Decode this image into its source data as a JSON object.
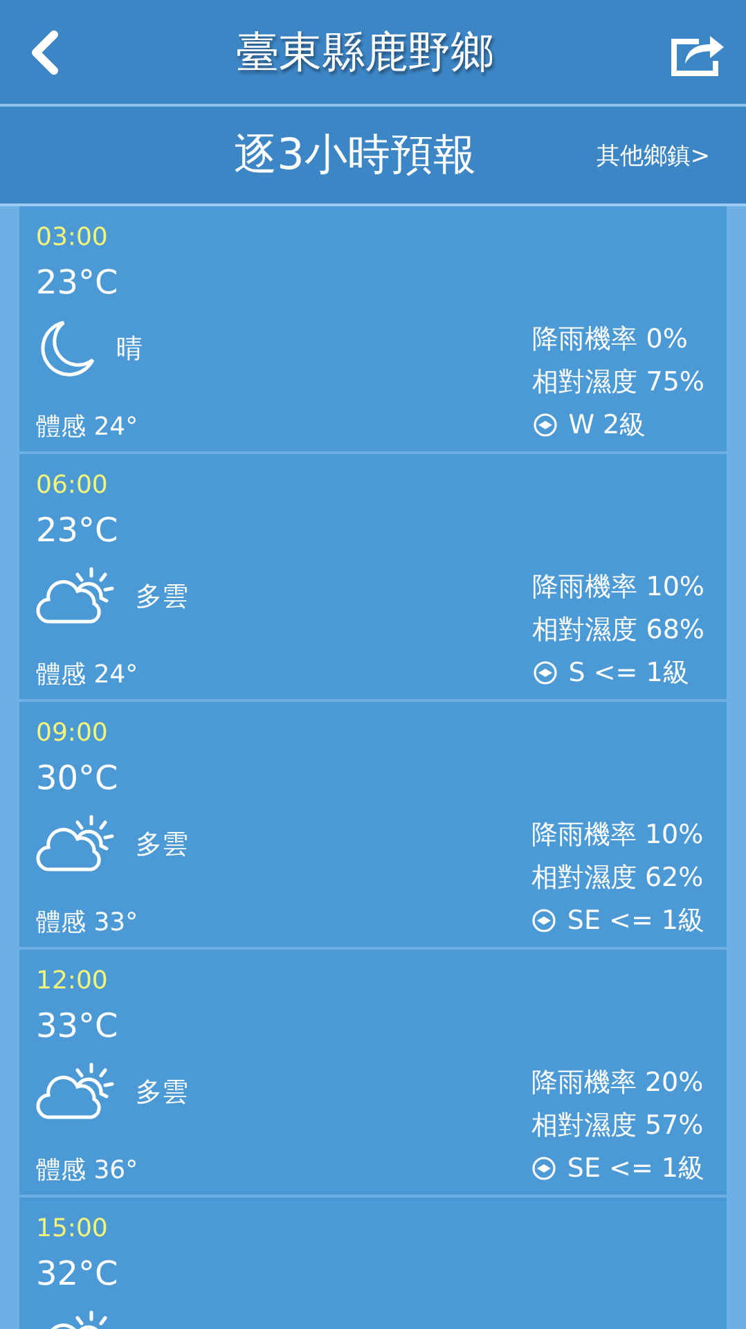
{
  "header": {
    "title": "臺東縣鹿野鄉"
  },
  "subheader": {
    "title": "逐3小時預報",
    "link": "其他鄉鎮>"
  },
  "forecasts": [
    {
      "time": "03:00",
      "temperature": "23°C",
      "kind": "moon",
      "condition": "晴",
      "feels_like": "體感 24°",
      "rain": "降雨機率 0%",
      "humidity": "相對濕度 75%",
      "wind": "W 2級"
    },
    {
      "time": "06:00",
      "temperature": "23°C",
      "kind": "partly-cloudy",
      "condition": "多雲",
      "feels_like": "體感 24°",
      "rain": "降雨機率 10%",
      "humidity": "相對濕度 68%",
      "wind": "S <= 1級"
    },
    {
      "time": "09:00",
      "temperature": "30°C",
      "kind": "partly-cloudy",
      "condition": "多雲",
      "feels_like": "體感 33°",
      "rain": "降雨機率 10%",
      "humidity": "相對濕度 62%",
      "wind": "SE <= 1級"
    },
    {
      "time": "12:00",
      "temperature": "33°C",
      "kind": "partly-cloudy",
      "condition": "多雲",
      "feels_like": "體感 36°",
      "rain": "降雨機率 20%",
      "humidity": "相對濕度 57%",
      "wind": "SE <= 1級"
    },
    {
      "time": "15:00",
      "temperature": "32°C",
      "kind": "partly-cloudy"
    }
  ]
}
